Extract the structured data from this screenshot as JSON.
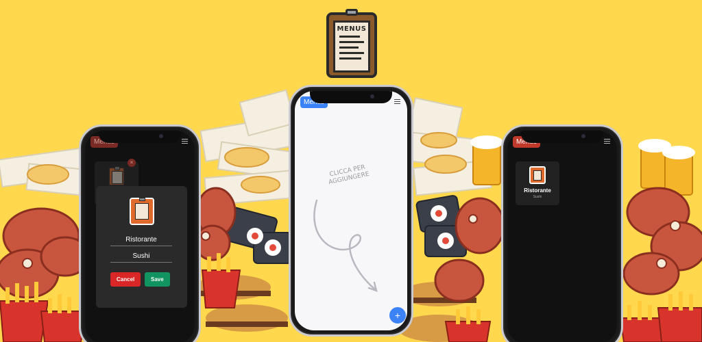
{
  "logo": {
    "text": "MENUS"
  },
  "left_phone": {
    "menus_label": "Menus",
    "dialog": {
      "name_value": "Ristorante",
      "type_value": "Sushi",
      "cancel_label": "Cancel",
      "save_label": "Save"
    }
  },
  "center_phone": {
    "menus_label": "Menus",
    "hint_text": "CLICCA PER AGGIUNGERE",
    "add_label": "+"
  },
  "right_phone": {
    "menus_label": "Menus",
    "card": {
      "title": "Ristorante",
      "subtitle": "Sushi"
    }
  },
  "colors": {
    "background": "#ffd84d",
    "primary_blue": "#3b82f6",
    "cancel_red": "#d92626",
    "save_green": "#129460",
    "menus_red": "#c0392b"
  }
}
